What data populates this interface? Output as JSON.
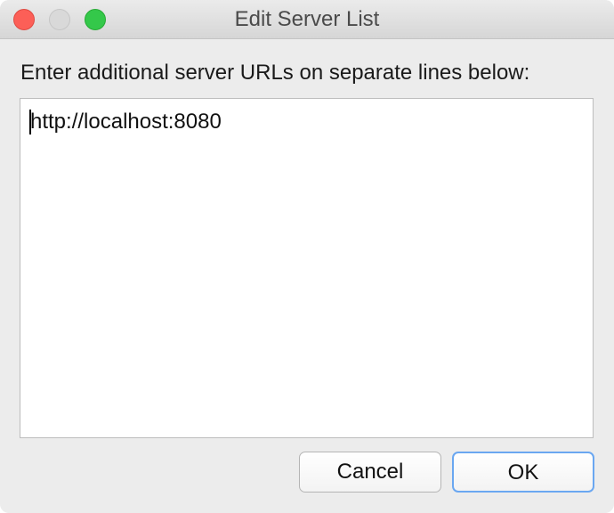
{
  "window": {
    "title": "Edit Server List"
  },
  "dialog": {
    "prompt": "Enter additional server URLs on separate lines below:",
    "server_list": [
      "http://localhost:8080"
    ],
    "buttons": {
      "cancel": "Cancel",
      "ok": "OK"
    }
  },
  "colors": {
    "close": "#fc5f57",
    "minimize": "#d9d9d9",
    "zoom": "#34c84a",
    "default_button_border": "#6aa7f1"
  }
}
